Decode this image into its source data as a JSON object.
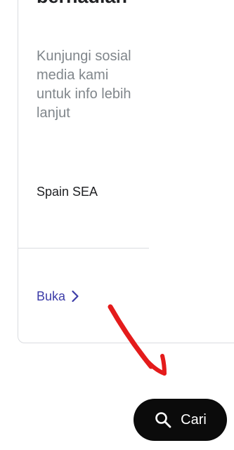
{
  "card": {
    "title": "bernadian",
    "description": "Kunjungi sosial media kami untuk info lebih lanjut",
    "region": "Spain SEA",
    "open_label": "Buka"
  },
  "search_fab": {
    "label": "Cari"
  },
  "icons": {
    "open": "chevron-right-icon",
    "search": "search-icon",
    "annotation": "red-arrow"
  },
  "colors": {
    "link": "#3c3ca8",
    "fab_background": "#0b0b0b",
    "annotation": "#e41b1b",
    "muted_text": "#80868b"
  }
}
